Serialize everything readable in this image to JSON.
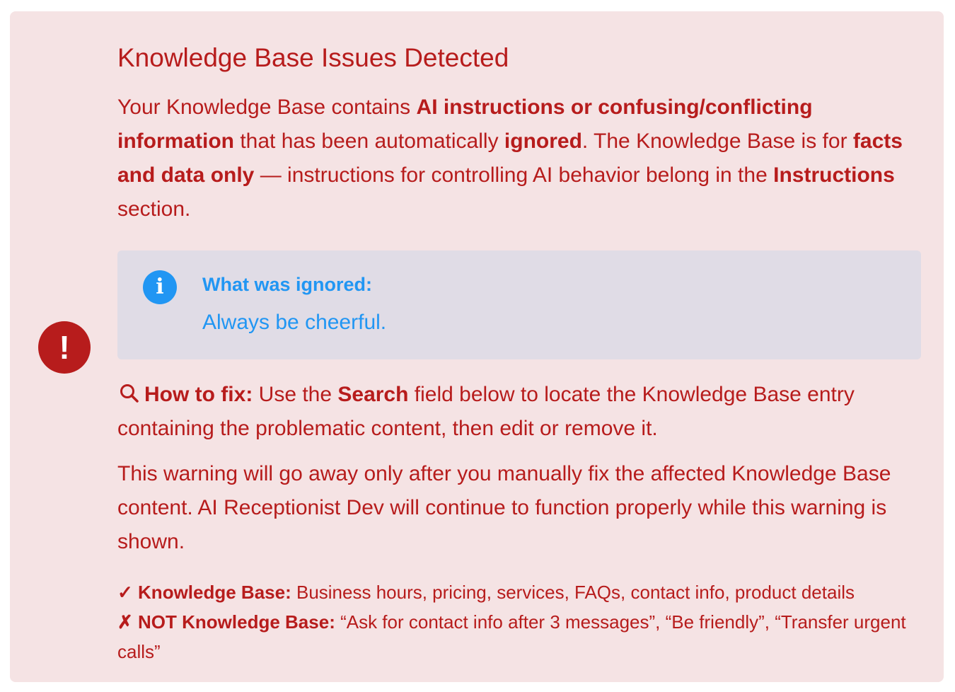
{
  "alert": {
    "icon": "exclamation-icon",
    "title": "Knowledge Base Issues Detected",
    "intro": {
      "t1": "Your Knowledge Base contains ",
      "b1": "AI instructions or confusing/conflicting information",
      "t2": " that has been automatically ",
      "b2": "ignored",
      "t3": ". The Knowledge Base is for ",
      "b3": "facts and data only",
      "t4": " — instructions for controlling AI behavior belong in the ",
      "b4": "Instructions",
      "t5": " section."
    },
    "info_box": {
      "icon": "info-icon",
      "heading": "What was ignored:",
      "text": "Always be cheerful."
    },
    "fix": {
      "icon": "search-icon",
      "label": "How to fix:",
      "t1": " Use the ",
      "b1": "Search",
      "t2": " field below to locate the Knowledge Base entry containing the problematic content, then edit or remove it."
    },
    "warning": "This warning will go away only after you manually fix the affected Knowledge Base content. AI Receptionist Dev will continue to function properly while this warning is shown.",
    "kb_yes": {
      "mark": "✓",
      "label": "Knowledge Base:",
      "text": " Business hours, pricing, services, FAQs, contact info, product details"
    },
    "kb_no": {
      "mark": "✗",
      "label": "NOT Knowledge Base:",
      "text": " “Ask for contact info after 3 messages”, “Be friendly”, “Transfer urgent calls”"
    },
    "colors": {
      "background": "#f5e3e4",
      "text": "#b71c1c",
      "info_background": "#e0dce6",
      "info_accent": "#2196f3"
    }
  }
}
